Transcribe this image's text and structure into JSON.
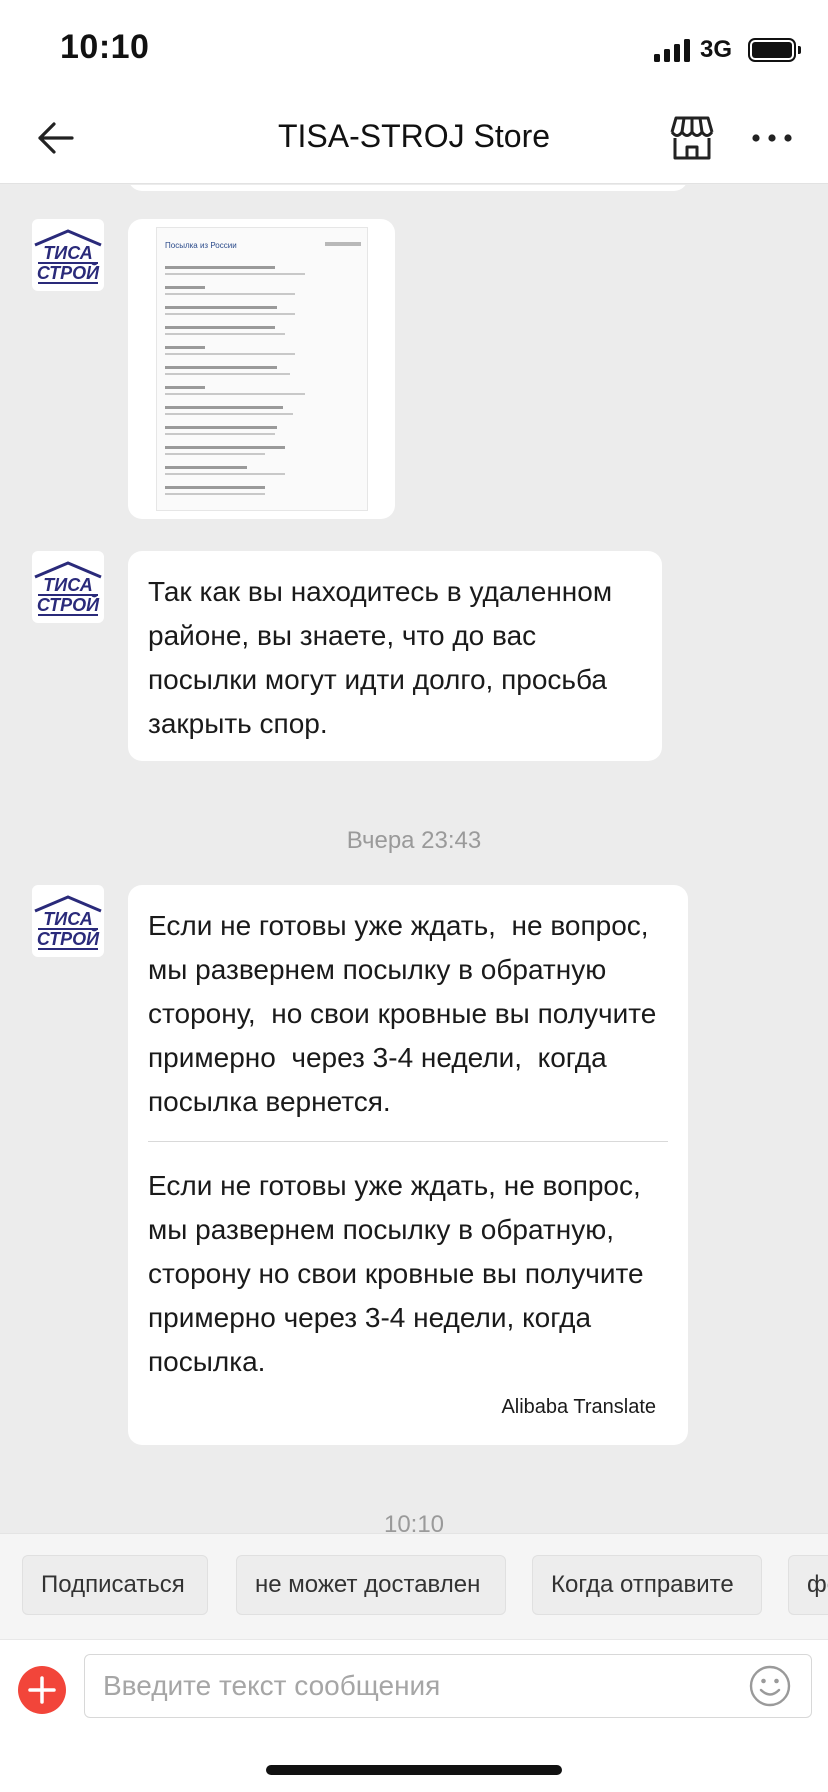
{
  "status_bar": {
    "time": "10:10",
    "network": "3G"
  },
  "header": {
    "title": "TISA-STROJ Store"
  },
  "messages": [
    {
      "type": "image",
      "thumbnail": {
        "heading": "Посылка из России",
        "rows": [
          "",
          "",
          "",
          "",
          "",
          "",
          "",
          "",
          "",
          "",
          "",
          "",
          ""
        ]
      }
    },
    {
      "type": "text",
      "text": "Так как вы находитесь в удаленном районе, вы знаете, что до вас посылки могут идти долго, просьба закрыть спор."
    }
  ],
  "timestamp_1": "Вчера 23:43",
  "message_3": {
    "original": "Если не готовы уже ждать,  не вопрос, мы развернем посылку в обратную сторону,  но свои кровные вы получите примерно  через 3-4 недели,  когда посылка вернется.",
    "translated": "Если не готовы уже ждать, не вопрос, мы развернем посылку в обратную, сторону но свои кровные вы получите примерно через 3-4 недели, когда посылка.",
    "translate_note": "Alibaba Translate"
  },
  "timestamp_2": "10:10",
  "quick_replies": [
    "Подписаться",
    "не может доставлен",
    "Когда отправите",
    "фо"
  ],
  "input": {
    "placeholder": "Введите текст сообщения"
  },
  "avatar_logo": {
    "top": "ТИСА",
    "bottom": "СТРОЙ"
  },
  "colors": {
    "accent": "#f2453a",
    "chat_bg": "#ececec",
    "logo_blue": "#2a2a7a"
  }
}
